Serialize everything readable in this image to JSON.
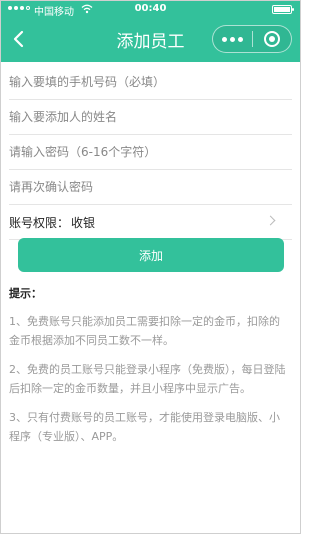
{
  "status_bar": {
    "carrier": "中国移动",
    "time": "00:40"
  },
  "navbar": {
    "title": "添加员工",
    "back_icon": "back-arrow-icon",
    "more_icon": "more-dots-icon",
    "close_icon": "miniapp-close-icon"
  },
  "form": {
    "phone_placeholder": "输入要填的手机号码（必填）",
    "name_placeholder": "输入要添加人的姓名",
    "password_placeholder": "请输入密码（6-16个字符）",
    "confirm_placeholder": "请再次确认密码",
    "permission_label": "账号权限：",
    "permission_value": "收银",
    "add_button": "添加"
  },
  "tips": {
    "title": "提示：",
    "items": [
      "1、免费账号只能添加员工需要扣除一定的金币，扣除的金币根据添加不同员工数不一样。",
      "2、免费的员工账号只能登录小程序（免费版），每日登陆后扣除一定的金币数量，并且小程序中显示广告。",
      "3、只有付费账号的员工账号，才能使用登录电脑版、小程序（专业版）、APP。"
    ]
  },
  "colors": {
    "accent": "#33c19b"
  }
}
